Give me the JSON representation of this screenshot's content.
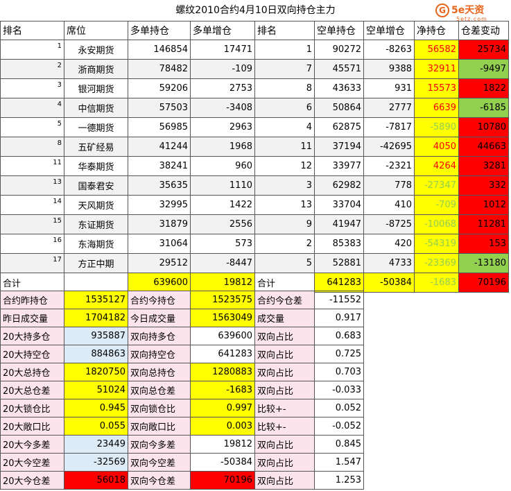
{
  "title": "螺纹2010合约4月10日双向持仓主力",
  "logo": {
    "badge": "G",
    "text": "5e天资",
    "sub": "5etz.com"
  },
  "headers": [
    "排名",
    "席位",
    "多单持仓",
    "多单增仓",
    "排名",
    "空单持仓",
    "空单增仓",
    "净持仓",
    "仓差变动"
  ],
  "rows": [
    {
      "rank": "1",
      "name": "永安期货",
      "long": "146854",
      "longchg": "17471",
      "srank": "1",
      "short": "90272",
      "shortchg": "-8263",
      "net": "56582",
      "diff": "25734"
    },
    {
      "rank": "2",
      "name": "浙商期货",
      "long": "78482",
      "longchg": "-109",
      "srank": "7",
      "short": "45571",
      "shortchg": "9388",
      "net": "32911",
      "diff": "-9497"
    },
    {
      "rank": "3",
      "name": "银河期货",
      "long": "59206",
      "longchg": "2753",
      "srank": "8",
      "short": "43633",
      "shortchg": "931",
      "net": "15573",
      "diff": "1822"
    },
    {
      "rank": "4",
      "name": "中信期货",
      "long": "57503",
      "longchg": "-3408",
      "srank": "6",
      "short": "50864",
      "shortchg": "2777",
      "net": "6639",
      "diff": "-6185"
    },
    {
      "rank": "5",
      "name": "一德期货",
      "long": "56985",
      "longchg": "2963",
      "srank": "4",
      "short": "62875",
      "shortchg": "-7817",
      "net": "-5890",
      "diff": "10780"
    },
    {
      "rank": "8",
      "name": "五矿经易",
      "long": "41244",
      "longchg": "1968",
      "srank": "11",
      "short": "37194",
      "shortchg": "-42695",
      "net": "4050",
      "diff": "44663"
    },
    {
      "rank": "11",
      "name": "华泰期货",
      "long": "38241",
      "longchg": "960",
      "srank": "12",
      "short": "33977",
      "shortchg": "-2321",
      "net": "4264",
      "diff": "3281"
    },
    {
      "rank": "13",
      "name": "国泰君安",
      "long": "35635",
      "longchg": "1110",
      "srank": "3",
      "short": "62982",
      "shortchg": "778",
      "net": "-27347",
      "diff": "332"
    },
    {
      "rank": "14",
      "name": "天风期货",
      "long": "32995",
      "longchg": "1422",
      "srank": "13",
      "short": "33704",
      "shortchg": "410",
      "net": "-709",
      "diff": "1012"
    },
    {
      "rank": "15",
      "name": "东证期货",
      "long": "31879",
      "longchg": "2556",
      "srank": "9",
      "short": "41947",
      "shortchg": "-8725",
      "net": "-10068",
      "diff": "11281"
    },
    {
      "rank": "16",
      "name": "东海期货",
      "long": "31064",
      "longchg": "573",
      "srank": "2",
      "short": "85383",
      "shortchg": "420",
      "net": "-54319",
      "diff": "153"
    },
    {
      "rank": "17",
      "name": "方正中期",
      "long": "29512",
      "longchg": "-8447",
      "srank": "5",
      "short": "52881",
      "shortchg": "4733",
      "net": "-23369",
      "diff": "-13180"
    }
  ],
  "total": {
    "label": "合计",
    "long": "639600",
    "longchg": "19812",
    "label2": "合计",
    "short": "641283",
    "shortchg": "-50384",
    "net": "-1683",
    "diff": "70196"
  },
  "stats": [
    {
      "l1": "合约昨持仓",
      "v1": "1535127",
      "l2": "合约今持仓",
      "v2": "1523575",
      "l3": "合约今仓差",
      "v3": "-11552"
    },
    {
      "l1": "昨日成交量",
      "v1": "1704182",
      "l2": "今日成交量",
      "v2": "1563049",
      "l3": "成交量",
      "v3": "0.917"
    },
    {
      "l1": "20大持多仓",
      "v1": "935887",
      "l2": "双向持多仓",
      "v2": "639600",
      "l3": "双向占比",
      "v3": "0.683"
    },
    {
      "l1": "20大持空仓",
      "v1": "884863",
      "l2": "双向持空仓",
      "v2": "641283",
      "l3": "双向占比",
      "v3": "0.725"
    },
    {
      "l1": "20大总持仓",
      "v1": "1820750",
      "l2": "双向总持仓",
      "v2": "1280883",
      "l3": "双向占比",
      "v3": "0.703"
    },
    {
      "l1": "20大总仓差",
      "v1": "51024",
      "l2": "双向总仓差",
      "v2": "-1683",
      "l3": "双向占比",
      "v3": "-0.033"
    },
    {
      "l1": "20大锁仓比",
      "v1": "0.945",
      "l2": "双向锁仓比",
      "v2": "0.997",
      "l3": "比较+-",
      "v3": "0.052"
    },
    {
      "l1": "20大敞口比",
      "v1": "0.055",
      "l2": "双向敞口比",
      "v2": "0.003",
      "l3": "比较+-",
      "v3": "-0.052"
    },
    {
      "l1": "20大今多差",
      "v1": "23449",
      "l2": "双向今多差",
      "v2": "19812",
      "l3": "双向占比",
      "v3": "0.845"
    },
    {
      "l1": "20大今空差",
      "v1": "-32569",
      "l2": "双向今空差",
      "v2": "-50384",
      "l3": "双向占比",
      "v3": "1.547"
    },
    {
      "l1": "20大今仓差",
      "v1": "56018",
      "l2": "双向今仓差",
      "v2": "70196",
      "l3": "双向占比",
      "v3": "1.253"
    }
  ],
  "colors": {
    "yellow": "#ffff00",
    "red": "#ff0000",
    "green": "#92d050",
    "blue": "#ddebf7",
    "pink": "#fce4ec"
  }
}
